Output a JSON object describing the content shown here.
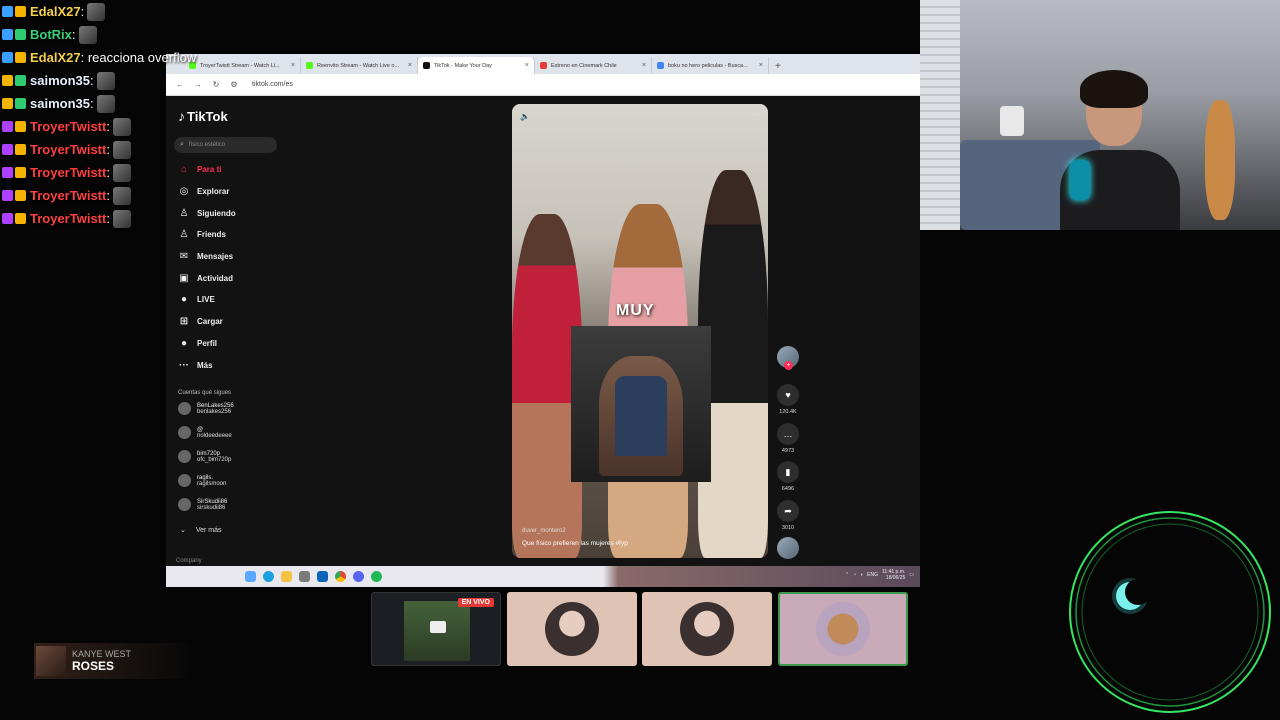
{
  "chat": [
    {
      "user": "EdalX27",
      "color": "#f5d04a",
      "msg": ":",
      "badges": [
        "#3aa0ff",
        "#f5b400"
      ],
      "emote": true
    },
    {
      "user": "BotRix",
      "color": "#35d07a",
      "msg": ":",
      "badges": [
        "#3aa0ff",
        "#2ecc71"
      ],
      "emote": true
    },
    {
      "user": "EdalX27",
      "color": "#f5d04a",
      "msg": ": reacciona overflow",
      "badges": [
        "#3aa0ff",
        "#f5b400"
      ],
      "emote": false
    },
    {
      "user": "saimon35",
      "color": "#e8f0ff",
      "msg": ":",
      "badges": [
        "#f5b400",
        "#2ecc71"
      ],
      "emote": true
    },
    {
      "user": "saimon35",
      "color": "#e8f0ff",
      "msg": ":",
      "badges": [
        "#f5b400",
        "#2ecc71"
      ],
      "emote": true
    },
    {
      "user": "TroyerTwistt",
      "color": "#ff4040",
      "msg": ":",
      "badges": [
        "#b040ff",
        "#f5b400"
      ],
      "emote": true
    },
    {
      "user": "TroyerTwistt",
      "color": "#ff4040",
      "msg": ":",
      "badges": [
        "#b040ff",
        "#f5b400"
      ],
      "emote": true
    },
    {
      "user": "TroyerTwistt",
      "color": "#ff4040",
      "msg": ":",
      "badges": [
        "#b040ff",
        "#f5b400"
      ],
      "emote": true
    },
    {
      "user": "TroyerTwistt",
      "color": "#ff4040",
      "msg": ":",
      "badges": [
        "#b040ff",
        "#f5b400"
      ],
      "emote": true
    },
    {
      "user": "TroyerTwistt",
      "color": "#ff4040",
      "msg": ":",
      "badges": [
        "#b040ff",
        "#f5b400"
      ],
      "emote": true
    }
  ],
  "browser": {
    "tabs": [
      {
        "label": "TroyerTwistt Stream - Watch Li...",
        "color": "#53fc18",
        "active": false
      },
      {
        "label": "Reenvito Stream - Watch Live o...",
        "color": "#53fc18",
        "active": false
      },
      {
        "label": "TikTok - Make Your Day",
        "color": "#111111",
        "active": true
      },
      {
        "label": "Estreno en Cinemark Chile",
        "color": "#e53935",
        "active": false
      },
      {
        "label": "boku no hero peliculas - Busca...",
        "color": "#4285f4",
        "active": false
      }
    ],
    "new_tab": "+",
    "url": "tiktok.com/es",
    "back": "←",
    "forward": "→",
    "reload": "↻"
  },
  "tiktok": {
    "logo": "TikTok",
    "search_placeholder": "físico estético",
    "nav": [
      {
        "label": "Para ti",
        "icon": "⌂",
        "active": true
      },
      {
        "label": "Explorar",
        "icon": "◎",
        "active": false
      },
      {
        "label": "Siguiendo",
        "icon": "♙",
        "active": false
      },
      {
        "label": "Friends",
        "icon": "♙",
        "active": false
      },
      {
        "label": "Mensajes",
        "icon": "✉",
        "active": false
      },
      {
        "label": "Actividad",
        "icon": "▣",
        "active": false
      },
      {
        "label": "LIVE",
        "icon": "●",
        "active": false
      },
      {
        "label": "Cargar",
        "icon": "⊞",
        "active": false
      },
      {
        "label": "Perfil",
        "icon": "●",
        "active": false
      },
      {
        "label": "Más",
        "icon": "···",
        "active": false
      }
    ],
    "following_title": "Cuentas que sigues",
    "accounts": [
      {
        "name": "BenLakes256",
        "handle": "benlakes256"
      },
      {
        "name": "@",
        "handle": "noldeedeeee"
      },
      {
        "name": "bim720p",
        "handle": "ofc_bim720p"
      },
      {
        "name": "ragils.",
        "handle": "ragilsmoon"
      },
      {
        "name": "SirSkudii86",
        "handle": "sirskudii86"
      }
    ],
    "see_more": "Ver más",
    "company": "Company",
    "video": {
      "overlay_text": "MUY",
      "author": "duver_montero2",
      "caption": "Que físico prefieren las mujeres #fyp"
    },
    "actions": {
      "likes": "120.4K",
      "comments": "4973",
      "saves": "6496",
      "shares": "3010"
    }
  },
  "taskbar": {
    "lang": "ENG",
    "time": "11:41 p.m.",
    "date": "18/06/25"
  },
  "participants": {
    "live_label": "EN VIVO"
  },
  "music": {
    "artist": "KANYE WEST",
    "song": "ROSES"
  },
  "colors": {
    "tiktok_accent": "#fe2c55",
    "ring": "#3cff6a",
    "speaking_border": "#3c9a4a"
  }
}
